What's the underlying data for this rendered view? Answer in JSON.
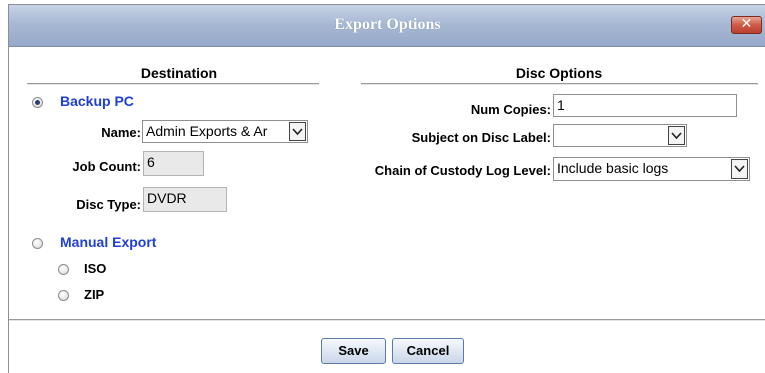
{
  "dialog": {
    "title": "Export Options",
    "close_glyph": "✕"
  },
  "destination": {
    "heading": "Destination",
    "backup_pc": {
      "label": "Backup PC",
      "selected": true,
      "name_label": "Name:",
      "name_value": "Admin Exports & Ar",
      "job_count_label": "Job Count:",
      "job_count_value": "6",
      "disc_type_label": "Disc Type:",
      "disc_type_value": "DVDR"
    },
    "manual_export": {
      "label": "Manual Export",
      "selected": false,
      "options": [
        {
          "label": "ISO",
          "selected": false
        },
        {
          "label": "ZIP",
          "selected": false
        }
      ]
    }
  },
  "disc_options": {
    "heading": "Disc Options",
    "num_copies_label": "Num Copies:",
    "num_copies_value": "1",
    "subject_label": "Subject on Disc Label:",
    "subject_value": "",
    "custody_label": "Chain of Custody Log Level:",
    "custody_value": "Include basic logs"
  },
  "buttons": {
    "save": "Save",
    "cancel": "Cancel"
  },
  "colors": {
    "title_bar": "#a8b9d4",
    "link_blue": "#1f3fd6",
    "close_red": "#cf5a46"
  }
}
